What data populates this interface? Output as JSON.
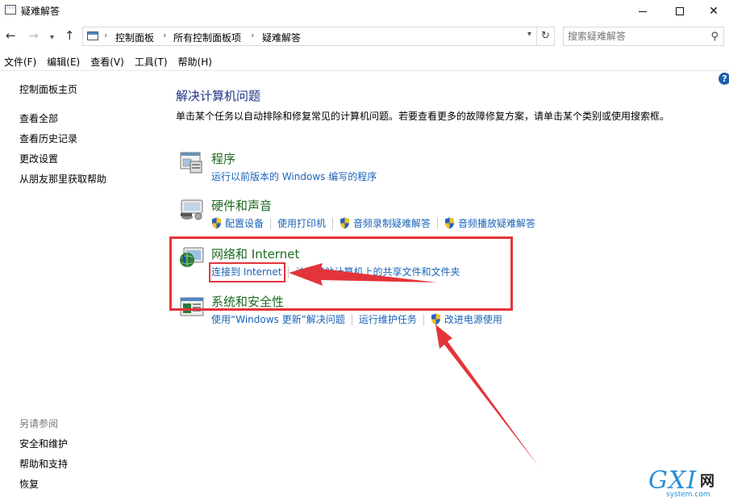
{
  "window": {
    "title": "疑难解答"
  },
  "address": {
    "breadcrumbs": [
      "控制面板",
      "所有控制面板项",
      "疑难解答"
    ],
    "search_placeholder": "搜索疑难解答"
  },
  "menubar": {
    "items": [
      "文件(F)",
      "编辑(E)",
      "查看(V)",
      "工具(T)",
      "帮助(H)"
    ]
  },
  "sidebar": {
    "items": [
      "控制面板主页",
      "查看全部",
      "查看历史记录",
      "更改设置",
      "从朋友那里获取帮助"
    ],
    "see_also_title": "另请参阅",
    "see_also": [
      "安全和维护",
      "帮助和支持",
      "恢复"
    ]
  },
  "main": {
    "title": "解决计算机问题",
    "description": "单击某个任务以自动排除和修复常见的计算机问题。若要查看更多的故障修复方案，请单击某个类别或使用搜索框。",
    "categories": [
      {
        "title": "程序",
        "icon": "programs-icon",
        "links": [
          "运行以前版本的 Windows 编写的程序"
        ]
      },
      {
        "title": "硬件和声音",
        "icon": "hardware-sound-icon",
        "links": [
          "配置设备",
          "使用打印机",
          "音频录制疑难解答",
          "音频播放疑难解答"
        ]
      },
      {
        "title": "网络和 Internet",
        "icon": "network-icon",
        "links": [
          "连接到 Internet",
          "访问其他计算机上的共享文件和文件夹"
        ]
      },
      {
        "title": "系统和安全性",
        "icon": "system-security-icon",
        "links": [
          "使用“Windows 更新”解决问题",
          "运行维护任务",
          "改进电源使用"
        ]
      }
    ]
  },
  "watermark": {
    "logo": "GXI",
    "cn": "网",
    "site": "system.com"
  },
  "colors": {
    "link": "#1963b8",
    "category_title": "#1c6a1f",
    "page_title": "#1e3287",
    "annotation": "#e3343a"
  }
}
